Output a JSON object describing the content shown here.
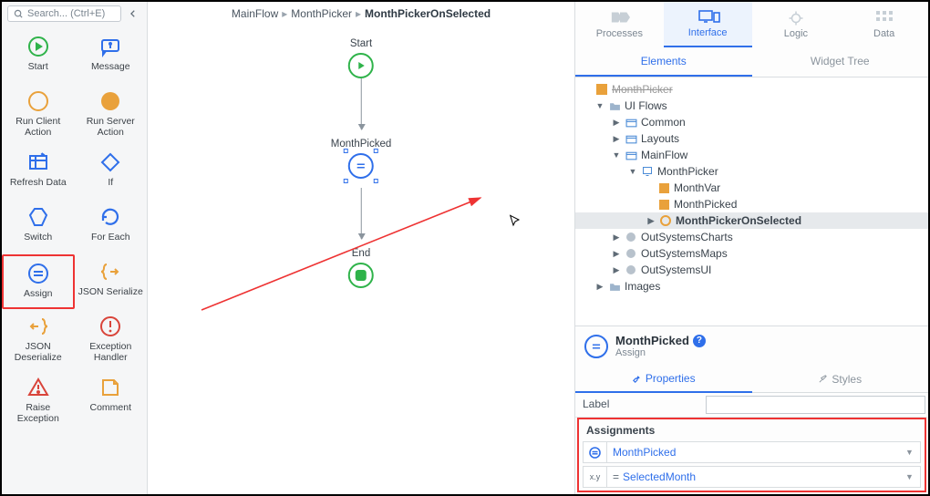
{
  "search": {
    "placeholder": "Search... (Ctrl+E)"
  },
  "toolbox": {
    "items": [
      {
        "label": "Start"
      },
      {
        "label": "Message"
      },
      {
        "label": "Run Client Action"
      },
      {
        "label": "Run Server Action"
      },
      {
        "label": "Refresh Data"
      },
      {
        "label": "If"
      },
      {
        "label": "Switch"
      },
      {
        "label": "For Each"
      },
      {
        "label": "Assign"
      },
      {
        "label": "JSON Serialize"
      },
      {
        "label": "JSON Deserialize"
      },
      {
        "label": "Exception Handler"
      },
      {
        "label": "Raise Exception"
      },
      {
        "label": "Comment"
      }
    ]
  },
  "breadcrumb": {
    "a": "MainFlow",
    "b": "MonthPicker",
    "c": "MonthPickerOnSelected"
  },
  "flow": {
    "start": "Start",
    "assign": "MonthPicked",
    "end": "End"
  },
  "topTabs": {
    "processes": "Processes",
    "interface": "Interface",
    "logic": "Logic",
    "data": "Data"
  },
  "subTabs": {
    "elements": "Elements",
    "widgetTree": "Widget Tree"
  },
  "tree": {
    "monthpicker": "MonthPicker",
    "uiflows": "UI Flows",
    "common": "Common",
    "layouts": "Layouts",
    "mainflow": "MainFlow",
    "monthpicker2": "MonthPicker",
    "monthvar": "MonthVar",
    "monthpicked": "MonthPicked",
    "monthpickeronselected": "MonthPickerOnSelected",
    "outsystemscharts": "OutSystemsCharts",
    "outsystemsmaps": "OutSystemsMaps",
    "outsystemsui": "OutSystemsUI",
    "images": "Images"
  },
  "propHeader": {
    "title": "MonthPicked",
    "subtitle": "Assign"
  },
  "propTabs": {
    "properties": "Properties",
    "styles": "Styles"
  },
  "props": {
    "labelKey": "Label",
    "labelVal": "",
    "assignmentsHdr": "Assignments",
    "assignVar": "MonthPicked",
    "assignVal": "SelectedMonth"
  }
}
